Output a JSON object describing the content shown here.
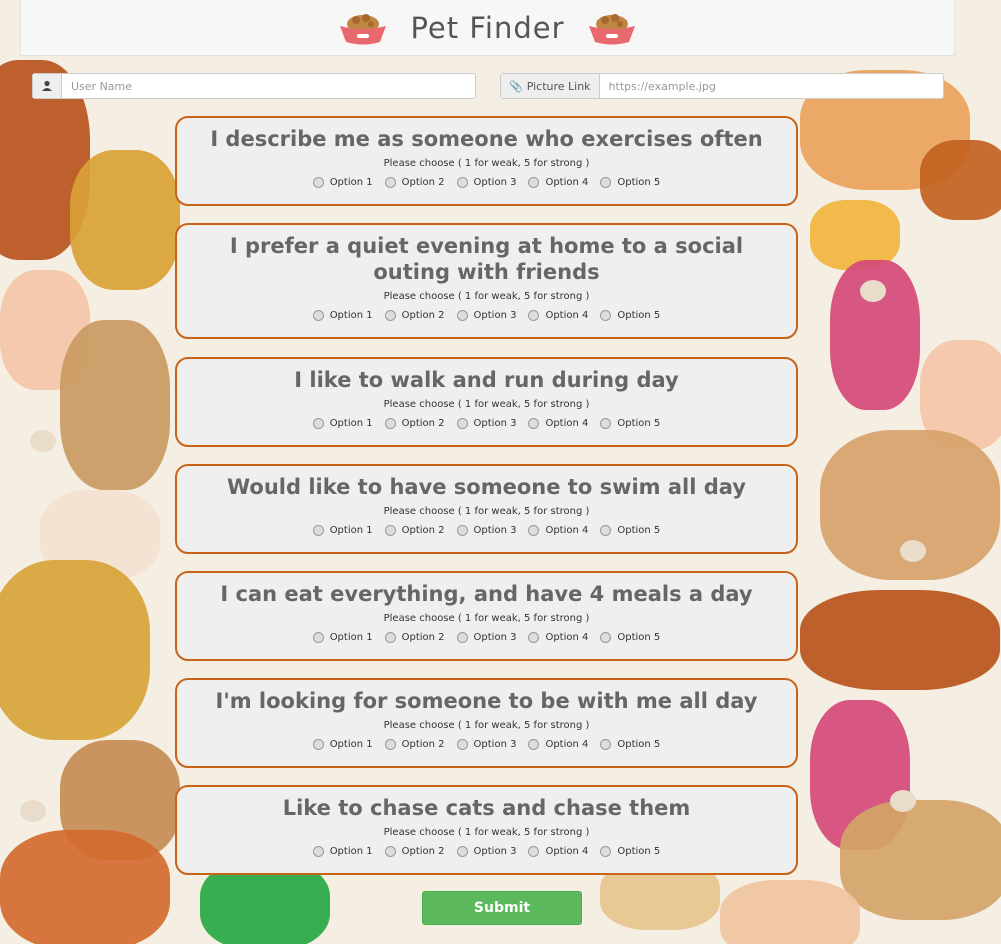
{
  "app": {
    "title": "Pet Finder"
  },
  "form": {
    "username": {
      "placeholder": "User Name",
      "value": ""
    },
    "picture": {
      "label": "Picture Link",
      "placeholder": "https://example.jpg",
      "value": ""
    }
  },
  "hint": "Please choose ( 1 for weak, 5 for strong )",
  "options": [
    "Option 1",
    "Option 2",
    "Option 3",
    "Option 4",
    "Option 5"
  ],
  "questions": [
    "I describe me as someone who exercises often",
    "I prefer a quiet evening at home to a social outing with friends",
    "I like to walk and run during day",
    "Would like to have someone to swim all day",
    "I can eat everything, and have 4 meals a day",
    "I'm looking for someone to be with me all day",
    "Like to chase cats and chase them"
  ],
  "submit_label": "Submit",
  "icons": {
    "user": "user-icon",
    "paperclip": "paperclip-icon",
    "bowl": "dog-bowl-icon"
  },
  "colors": {
    "card_border": "#c8641a",
    "submit": "#5cb85c"
  }
}
